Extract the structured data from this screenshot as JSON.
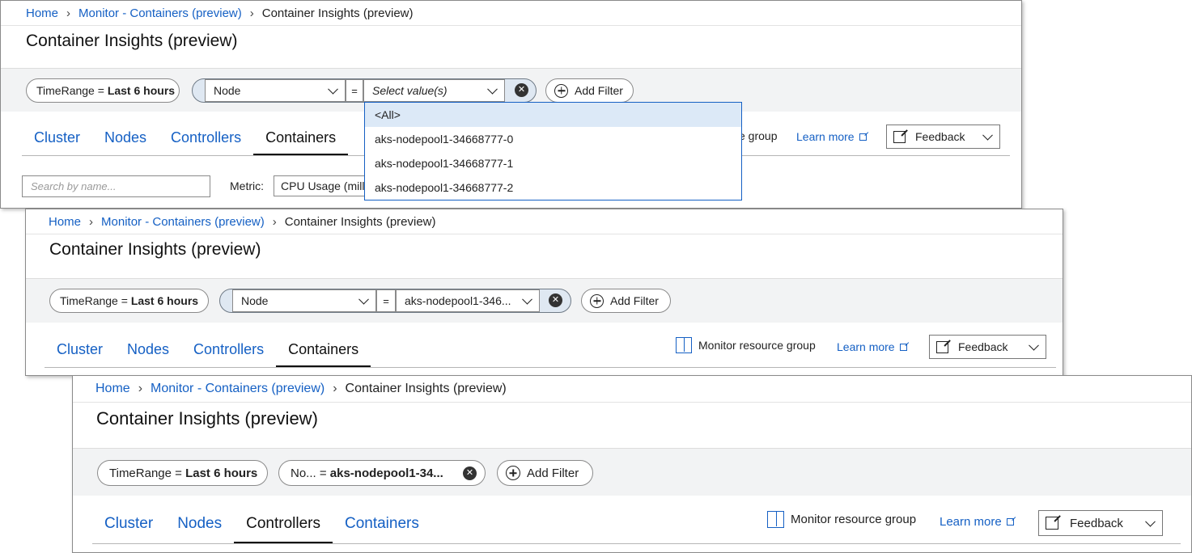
{
  "panels": [
    {
      "breadcrumb": {
        "home": "Home",
        "monitor": "Monitor - Containers (preview)",
        "current": "Container Insights (preview)"
      },
      "title": "Container Insights (preview)",
      "filters": {
        "timerange_label": "TimeRange =",
        "timerange_value": "Last 6 hours",
        "field": "Node",
        "eq": "=",
        "value": "Select value(s)",
        "add_filter": "Add Filter"
      },
      "tabs": [
        "Cluster",
        "Nodes",
        "Controllers",
        "Containers"
      ],
      "active_tab": "Containers",
      "monitor_partial": "e group",
      "learn_more": "Learn more",
      "feedback": "Feedback",
      "search_placeholder": "Search by name...",
      "metric_label": "Metric:",
      "metric_value": "CPU Usage (millic",
      "dropdown_options": [
        "<All>",
        "aks-nodepool1-34668777-0",
        "aks-nodepool1-34668777-1",
        "aks-nodepool1-34668777-2"
      ]
    },
    {
      "breadcrumb": {
        "home": "Home",
        "monitor": "Monitor - Containers (preview)",
        "current": "Container Insights (preview)"
      },
      "title": "Container Insights (preview)",
      "filters": {
        "timerange_label": "TimeRange =",
        "timerange_value": "Last 6 hours",
        "field": "Node",
        "eq": "=",
        "value": "aks-nodepool1-346...",
        "add_filter": "Add Filter"
      },
      "tabs": [
        "Cluster",
        "Nodes",
        "Controllers",
        "Containers"
      ],
      "active_tab": "Containers",
      "monitor_resource_group": "Monitor resource group",
      "learn_more": "Learn more",
      "feedback": "Feedback"
    },
    {
      "breadcrumb": {
        "home": "Home",
        "monitor": "Monitor - Containers (preview)",
        "current": "Container Insights (preview)"
      },
      "title": "Container Insights (preview)",
      "filters": {
        "timerange_label": "TimeRange =",
        "timerange_value": "Last 6 hours",
        "node_label": "No... =",
        "node_value": "aks-nodepool1-34...",
        "add_filter": "Add Filter"
      },
      "tabs": [
        "Cluster",
        "Nodes",
        "Controllers",
        "Containers"
      ],
      "active_tab": "Controllers",
      "monitor_resource_group": "Monitor resource group",
      "learn_more": "Learn more",
      "feedback": "Feedback"
    }
  ],
  "colors": {
    "link": "#1560c4",
    "band": "#f2f3f4",
    "highlight": "#dce9f7"
  }
}
